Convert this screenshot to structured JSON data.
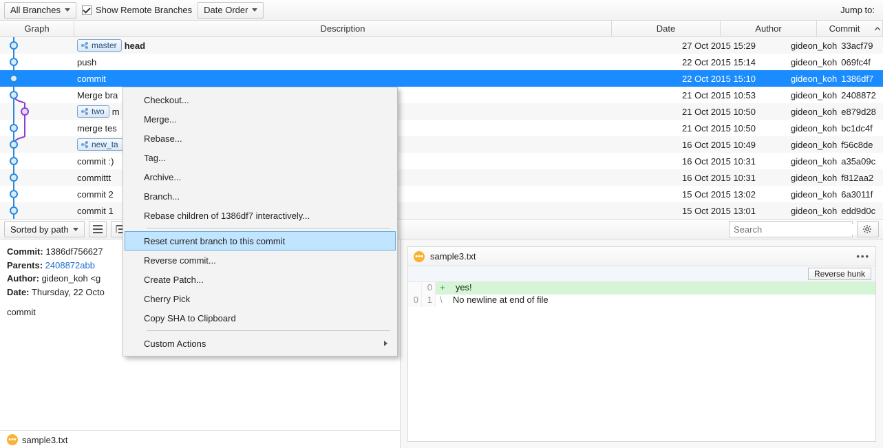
{
  "toolbar": {
    "branches_label": "All Branches",
    "show_remote_label": "Show Remote Branches",
    "date_order_label": "Date Order",
    "jump_to_label": "Jump to:"
  },
  "columns": {
    "graph": "Graph",
    "description": "Description",
    "date": "Date",
    "author": "Author",
    "commit": "Commit"
  },
  "commits": [
    {
      "desc_prefix_badge": "master",
      "desc": "head",
      "bold_desc": true,
      "date": "27 Oct 2015 15:29",
      "author": "gideon_koh <gkoh",
      "hash": "33acf79",
      "graph": "blue",
      "selected": false
    },
    {
      "desc": "push",
      "date": "22 Oct 2015 15:14",
      "author": "gideon_koh <gkoh",
      "hash": "069fc4f",
      "graph": "blue",
      "selected": false
    },
    {
      "desc": "commit",
      "date": "22 Oct 2015 15:10",
      "author": "gideon_koh <gkoh",
      "hash": "1386df7",
      "graph": "blue",
      "selected": true
    },
    {
      "desc": "Merge bra",
      "date": "21 Oct 2015 10:53",
      "author": "gideon_koh <gkoh",
      "hash": "2408872",
      "graph": "merge_start",
      "selected": false
    },
    {
      "desc_prefix_badge": "two",
      "desc": "m",
      "date": "21 Oct 2015 10:50",
      "author": "gideon_koh <gkoh",
      "hash": "e879d28",
      "graph": "purple_branch",
      "selected": false
    },
    {
      "desc": "merge tes",
      "date": "21 Oct 2015 10:50",
      "author": "gideon_koh <gkoh",
      "hash": "bc1dc4f",
      "graph": "dual",
      "selected": false
    },
    {
      "desc_prefix_badge": "new_ta",
      "desc": "",
      "date": "16 Oct 2015 10:49",
      "author": "gideon_koh <gkoh",
      "hash": "f56c8de",
      "graph": "merge_end",
      "selected": false
    },
    {
      "desc": "commit :)",
      "date": "16 Oct 2015 10:31",
      "author": "gideon_koh <gkoh",
      "hash": "a35a09c",
      "graph": "blue",
      "selected": false
    },
    {
      "desc": "committt",
      "date": "16 Oct 2015 10:31",
      "author": "gideon_koh <gkoh",
      "hash": "f812aa2",
      "graph": "blue",
      "selected": false
    },
    {
      "desc": "commit 2",
      "date": "15 Oct 2015 13:02",
      "author": "gideon_koh <gkoh",
      "hash": "6a3011f",
      "graph": "blue",
      "selected": false
    },
    {
      "desc": "commit 1",
      "date": "15 Oct 2015 13:01",
      "author": "gideon_koh <gkoh",
      "hash": "edd9d0c",
      "graph": "blue",
      "selected": false
    }
  ],
  "context_menu": {
    "items": [
      "Checkout...",
      "Merge...",
      "Rebase...",
      "Tag...",
      "Archive...",
      "Branch...",
      "Rebase children of 1386df7 interactively..."
    ],
    "hover_item": "Reset current branch to this commit",
    "items2": [
      "Reverse commit...",
      "Create Patch...",
      "Cherry Pick",
      "Copy SHA to Clipboard"
    ],
    "submenu_item": "Custom Actions"
  },
  "midbar": {
    "sorted_label": "Sorted by path",
    "search_placeholder": "Search"
  },
  "commit_detail": {
    "commit_label": "Commit:",
    "commit_value": "1386df756627",
    "parents_label": "Parents:",
    "parents_value": "2408872abb",
    "author_label": "Author:",
    "author_value": "gideon_koh <g",
    "date_label": "Date:",
    "date_value": "Thursday, 22 Octo",
    "message": "commit",
    "file": "sample3.txt"
  },
  "diff": {
    "file": "sample3.txt",
    "reverse_hunk": "Reverse hunk",
    "lines": [
      {
        "old": "",
        "new": "0",
        "type": "add",
        "prefix": "+",
        "text": "yes!"
      },
      {
        "old": "0",
        "new": "1",
        "type": "ctx",
        "prefix": "\\",
        "text": "No newline at end of file"
      }
    ]
  }
}
